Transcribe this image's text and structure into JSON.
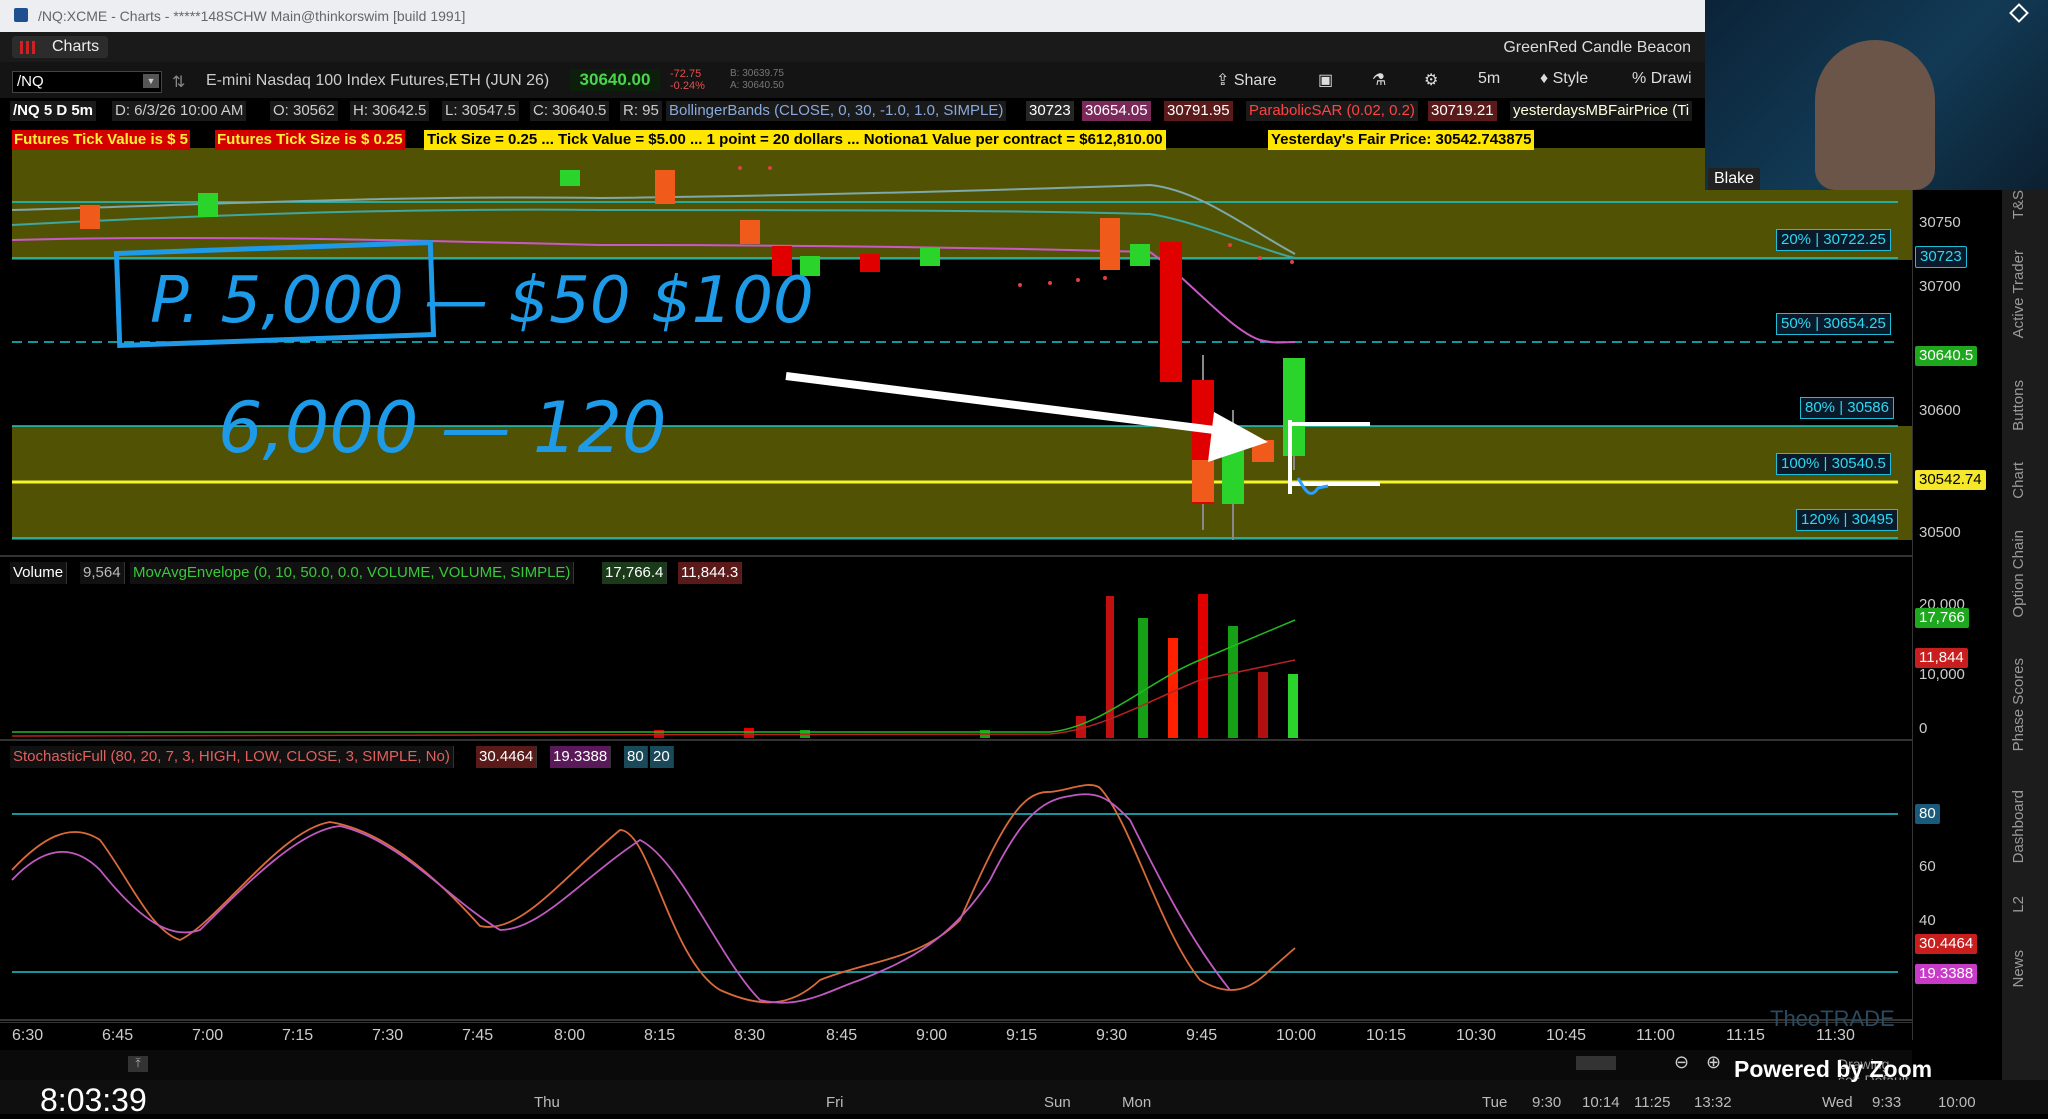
{
  "window": {
    "title": "/NQ:XCME - Charts - *****148SCHW Main@thinkorswim [build 1991]",
    "tab_label": "Charts",
    "beacon_label": "GreenRed Candle Beacon"
  },
  "toolbar": {
    "symbol": "/NQ",
    "description": "E-mini Nasdaq 100 Index Futures,ETH (JUN 26)",
    "last_price": "30640.00",
    "change": "-72.75",
    "change_pct": "-0.24%",
    "bid": "B: 30639.75",
    "ask": "A: 30640.50",
    "share_label": "Share",
    "interval_label": "5m",
    "style_label": "Style",
    "drawings_label": "Drawi"
  },
  "studies": {
    "chart_label": "/NQ 5 D 5m",
    "ohlc": "D: 6/3/26 10:00 AM",
    "open": "O: 30562",
    "high": "H: 30642.5",
    "low": "L: 30547.5",
    "close": "C: 30640.5",
    "range": "R: 95",
    "bb": "BollingerBands (CLOSE, 0, 30, -1.0, 1.0, SIMPLE)",
    "bb_upper": "30723",
    "bb_mid": "30654.05",
    "bb_lower": "30791.95",
    "sar": "ParabolicSAR (0.02, 0.2)",
    "sar_val": "30719.21",
    "fair": "yesterdaysMBFairPrice (Ti"
  },
  "info": {
    "tick_value": "Futures Tick Value is $ 5",
    "tick_size": "Futures Tick Size is $ 0.25",
    "summary": "Tick Size = 0.25 ... Tick Value = $5.00 ... 1 point = 20 dollars ... Notiona1 Value per contract = $612,810.00",
    "fair_price": "Yesterday's Fair Price: 30542.743875"
  },
  "levels": [
    {
      "label": "20% | 30722.25"
    },
    {
      "label": "50% | 30654.25"
    },
    {
      "label": "80% | 30586"
    },
    {
      "label": "100% | 30540.5"
    },
    {
      "label": "120% | 30495"
    }
  ],
  "price_axis": {
    "ticks": [
      "30750",
      "30700",
      "30650",
      "30600",
      "30550",
      "30500"
    ],
    "bb_upper_tag": "30723",
    "last_tag": "30640.5",
    "fair_tag": "30542.74"
  },
  "volume": {
    "label": "Volume",
    "value": "9,564",
    "env": "MovAvgEnvelope (0, 10, 50.0, 0.0, VOLUME, VOLUME, SIMPLE)",
    "upper": "17,766.4",
    "lower": "11,844.3",
    "axis_ticks": [
      "20,000",
      "10,000",
      "0"
    ],
    "tag_upper": "17,766",
    "tag_lower": "11,844"
  },
  "stoch": {
    "label": "StochasticFull (80, 20, 7, 3, HIGH, LOW, CLOSE, 3, SIMPLE, No)",
    "k": "30.4464",
    "d": "19.3388",
    "ob": "80",
    "os": "20",
    "axis_ticks": [
      "80",
      "60",
      "40"
    ],
    "tag_k": "30.4464",
    "tag_d": "19.3388"
  },
  "time_axis": [
    "6:30",
    "6:45",
    "7:00",
    "7:15",
    "7:30",
    "7:45",
    "8:00",
    "8:15",
    "8:30",
    "8:45",
    "9:00",
    "9:15",
    "9:30",
    "9:45",
    "10:00",
    "10:15",
    "10:30",
    "10:45",
    "11:00",
    "11:15",
    "11:30"
  ],
  "annotations": {
    "line1": "P. 5,000 - $50 $100",
    "line2": "6,000 - 120"
  },
  "side_tabs": [
    "T&S",
    "Active Trader",
    "Buttons",
    "Chart",
    "Option Chain",
    "Phase Scores",
    "Dashboard",
    "L2",
    "News"
  ],
  "bottom": {
    "clock": "8:03:39",
    "days": [
      "Thu",
      "Fri",
      "Sun",
      "Mon"
    ],
    "times_right": [
      "Tue",
      "9:30",
      "10:14",
      "11:25",
      "13:32",
      "Wed",
      "9:33",
      "10:00"
    ],
    "drawing_set": "Drawing set: Default",
    "zoom": "Powered by Zoom"
  },
  "webcam": {
    "name": "Blake",
    "brand": "TheoTRADE"
  }
}
